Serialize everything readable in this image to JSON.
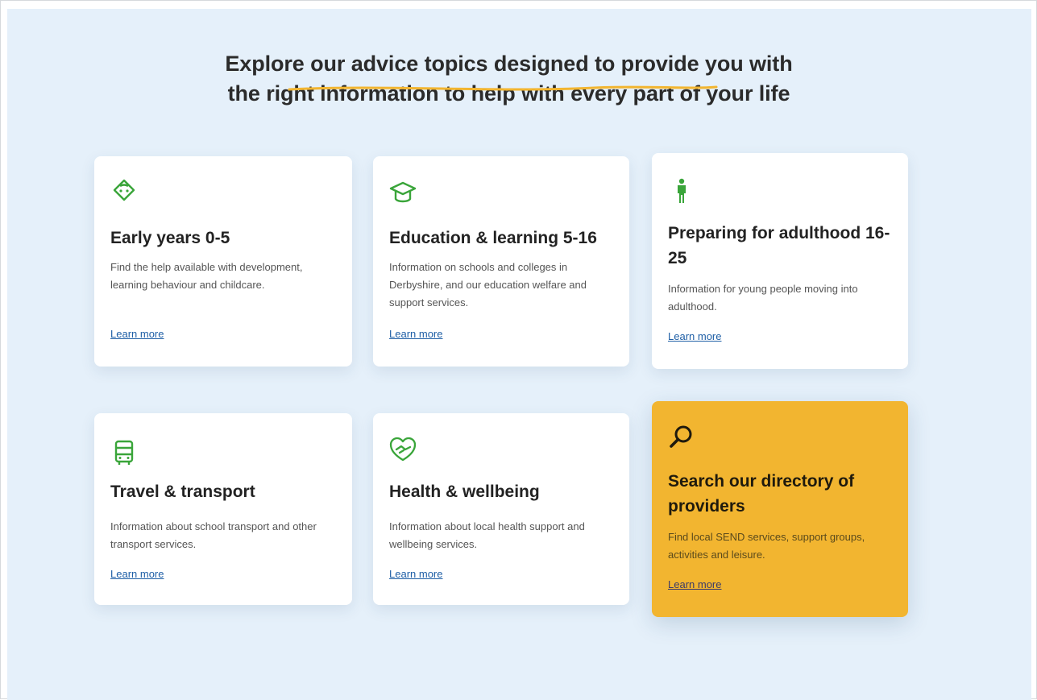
{
  "heading": {
    "line1": "Explore our advice topics designed to provide you with",
    "line2": "the right information to help with every part of your life"
  },
  "colors": {
    "panel_background": "#e5f0fa",
    "icon_green": "#3aa53a",
    "featured_card": "#f2b530",
    "link": "#1f5fa6",
    "underline_accent": "#f2b530"
  },
  "cards": [
    {
      "icon": "baby-face-icon",
      "title": "Early years 0-5",
      "description": "Find the help available with development, learning behaviour and childcare.",
      "link": "Learn more"
    },
    {
      "icon": "graduation-cap-icon",
      "title": "Education & learning 5-16",
      "description": "Information on schools and colleges in Derbyshire, and our education welfare and support services.",
      "link": "Learn more"
    },
    {
      "icon": "person-icon",
      "title": "Preparing for adulthood 16-25",
      "description": "Information for young people moving into adulthood.",
      "link": "Learn more"
    },
    {
      "icon": "bus-icon",
      "title": "Travel & transport",
      "description": "Information about school transport and other transport services.",
      "link": "Learn more"
    },
    {
      "icon": "heart-hands-icon",
      "title": "Health & wellbeing",
      "description": "Information about local health support and wellbeing services.",
      "link": "Learn more"
    },
    {
      "icon": "magnifying-glass-icon",
      "title": "Search our directory of providers",
      "description": "Find local SEND services, support groups, activities and leisure.",
      "link": "Learn more"
    }
  ]
}
